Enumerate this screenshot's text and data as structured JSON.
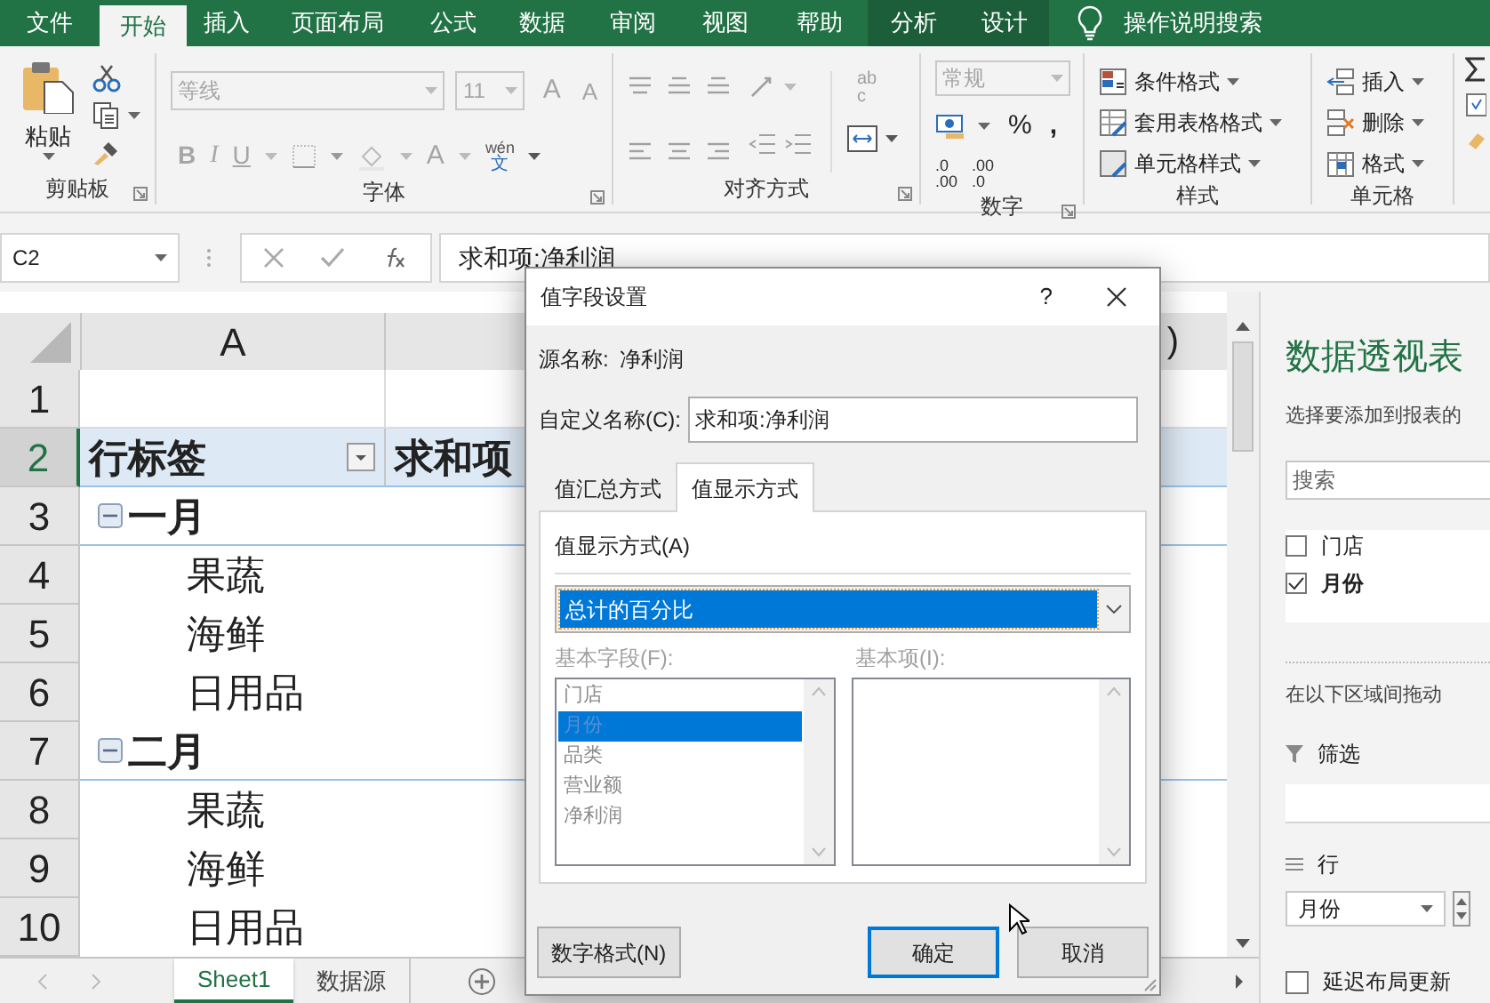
{
  "ribbon_tabs": [
    {
      "label": "文件",
      "selected": false,
      "contextual": false
    },
    {
      "label": "开始",
      "selected": true,
      "contextual": false
    },
    {
      "label": "插入",
      "selected": false,
      "contextual": false
    },
    {
      "label": "页面布局",
      "selected": false,
      "contextual": false
    },
    {
      "label": "公式",
      "selected": false,
      "contextual": false
    },
    {
      "label": "数据",
      "selected": false,
      "contextual": false
    },
    {
      "label": "审阅",
      "selected": false,
      "contextual": false
    },
    {
      "label": "视图",
      "selected": false,
      "contextual": false
    },
    {
      "label": "帮助",
      "selected": false,
      "contextual": false
    },
    {
      "label": "分析",
      "selected": false,
      "contextual": true
    },
    {
      "label": "设计",
      "selected": false,
      "contextual": true
    }
  ],
  "tell_me": "操作说明搜索",
  "ribbon": {
    "clipboard": {
      "label": "剪贴板",
      "paste": "粘贴"
    },
    "font": {
      "label": "字体",
      "disabled": true,
      "font_name": "等线",
      "font_size": "11",
      "grow": "A",
      "shrink": "A",
      "bold": "B",
      "italic": "I",
      "underline": "U",
      "font_color": "A",
      "phonetic_top": "wén",
      "phonetic_bottom": "文"
    },
    "alignment": {
      "label": "对齐方式",
      "disabled": true,
      "wrap_top": "ab",
      "wrap_bottom": "c"
    },
    "number": {
      "label": "数字",
      "format": "常规",
      "format_disabled": true,
      "percent": "%",
      "comma": ",",
      "increase_decimal": [
        ".0",
        ".00"
      ],
      "decrease_decimal": [
        ".00",
        ".0"
      ]
    },
    "styles": {
      "label": "样式",
      "items": [
        "条件格式",
        "套用表格格式",
        "单元格样式"
      ]
    },
    "cells": {
      "label": "单元格",
      "items": [
        "插入",
        "删除",
        "格式"
      ]
    }
  },
  "formula_bar": {
    "name_box": "C2",
    "formula": "求和项:净利润"
  },
  "sheet": {
    "columns": [
      "A"
    ],
    "column_fragment": ")",
    "rows": [
      {
        "number": "1",
        "selected": false,
        "kind": "blank"
      },
      {
        "number": "2",
        "selected": true,
        "kind": "header",
        "label": "行标签",
        "value_header": "求和项"
      },
      {
        "number": "3",
        "selected": false,
        "kind": "group",
        "label": "一月",
        "expanded": true
      },
      {
        "number": "4",
        "selected": false,
        "kind": "item",
        "label": "果蔬"
      },
      {
        "number": "5",
        "selected": false,
        "kind": "item",
        "label": "海鲜"
      },
      {
        "number": "6",
        "selected": false,
        "kind": "item",
        "label": "日用品"
      },
      {
        "number": "7",
        "selected": false,
        "kind": "group",
        "label": "二月",
        "expanded": true
      },
      {
        "number": "8",
        "selected": false,
        "kind": "item",
        "label": "果蔬"
      },
      {
        "number": "9",
        "selected": false,
        "kind": "item",
        "label": "海鲜"
      },
      {
        "number": "10",
        "selected": false,
        "kind": "item",
        "label": "日用品"
      }
    ]
  },
  "sheet_tabs": [
    {
      "label": "Sheet1",
      "selected": true
    },
    {
      "label": "数据源",
      "selected": false
    }
  ],
  "pivot_pane": {
    "title": "数据透视表",
    "subtitle": "选择要添加到报表的",
    "search_placeholder": "搜索",
    "fields": [
      {
        "label": "门店",
        "checked": false
      },
      {
        "label": "月份",
        "checked": true
      }
    ],
    "drag_hint": "在以下区域间拖动",
    "filter_label": "筛选",
    "rows_label": "行",
    "row_field": "月份",
    "defer_label": "延迟布局更新",
    "defer_checked": false
  },
  "dialog": {
    "title": "值字段设置",
    "help": "?",
    "source_label": "源名称:",
    "source_value": "净利润",
    "custom_name_label": "自定义名称(C):",
    "custom_name": "求和项:净利润",
    "tabs": [
      {
        "label": "值汇总方式",
        "selected": false
      },
      {
        "label": "值显示方式",
        "selected": true
      }
    ],
    "show_values_label": "值显示方式(A)",
    "show_values_as": "总计的百分比",
    "base_field_label": "基本字段(F):",
    "base_item_label": "基本项(I):",
    "lists_disabled": true,
    "base_fields": [
      {
        "label": "门店",
        "selected": false
      },
      {
        "label": "月份",
        "selected": true
      },
      {
        "label": "品类",
        "selected": false
      },
      {
        "label": "营业额",
        "selected": false
      },
      {
        "label": "净利润",
        "selected": false
      }
    ],
    "buttons": {
      "number_format": "数字格式(N)",
      "ok": "确定",
      "cancel": "取消"
    }
  }
}
